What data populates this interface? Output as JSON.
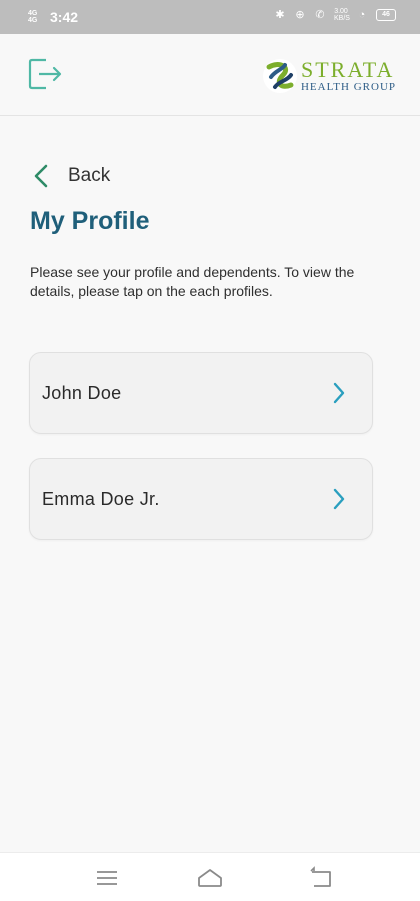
{
  "status_bar": {
    "network_label": "4G\n4G",
    "time": "3:42",
    "speed": "3.00\nKB/S",
    "battery": "46"
  },
  "header": {
    "logout_icon": "logout-icon",
    "brand": {
      "name": "STRATA",
      "subtitle": "HEALTH GROUP",
      "name_color": "#7cae2c",
      "subtitle_color": "#2d5c86"
    }
  },
  "main": {
    "back_label": "Back",
    "title": "My Profile",
    "intro": "Please see your profile and dependents. To view the details, please tap on the each profiles.",
    "profiles": [
      {
        "name": "John Doe"
      },
      {
        "name": "Emma Doe Jr."
      }
    ]
  },
  "nav_bar": {
    "icons": [
      "menu-icon",
      "home-icon",
      "back-icon"
    ]
  },
  "colors": {
    "accent": "#2a9fbf",
    "back_chevron": "#2e8b67",
    "title": "#1f5f7a"
  }
}
